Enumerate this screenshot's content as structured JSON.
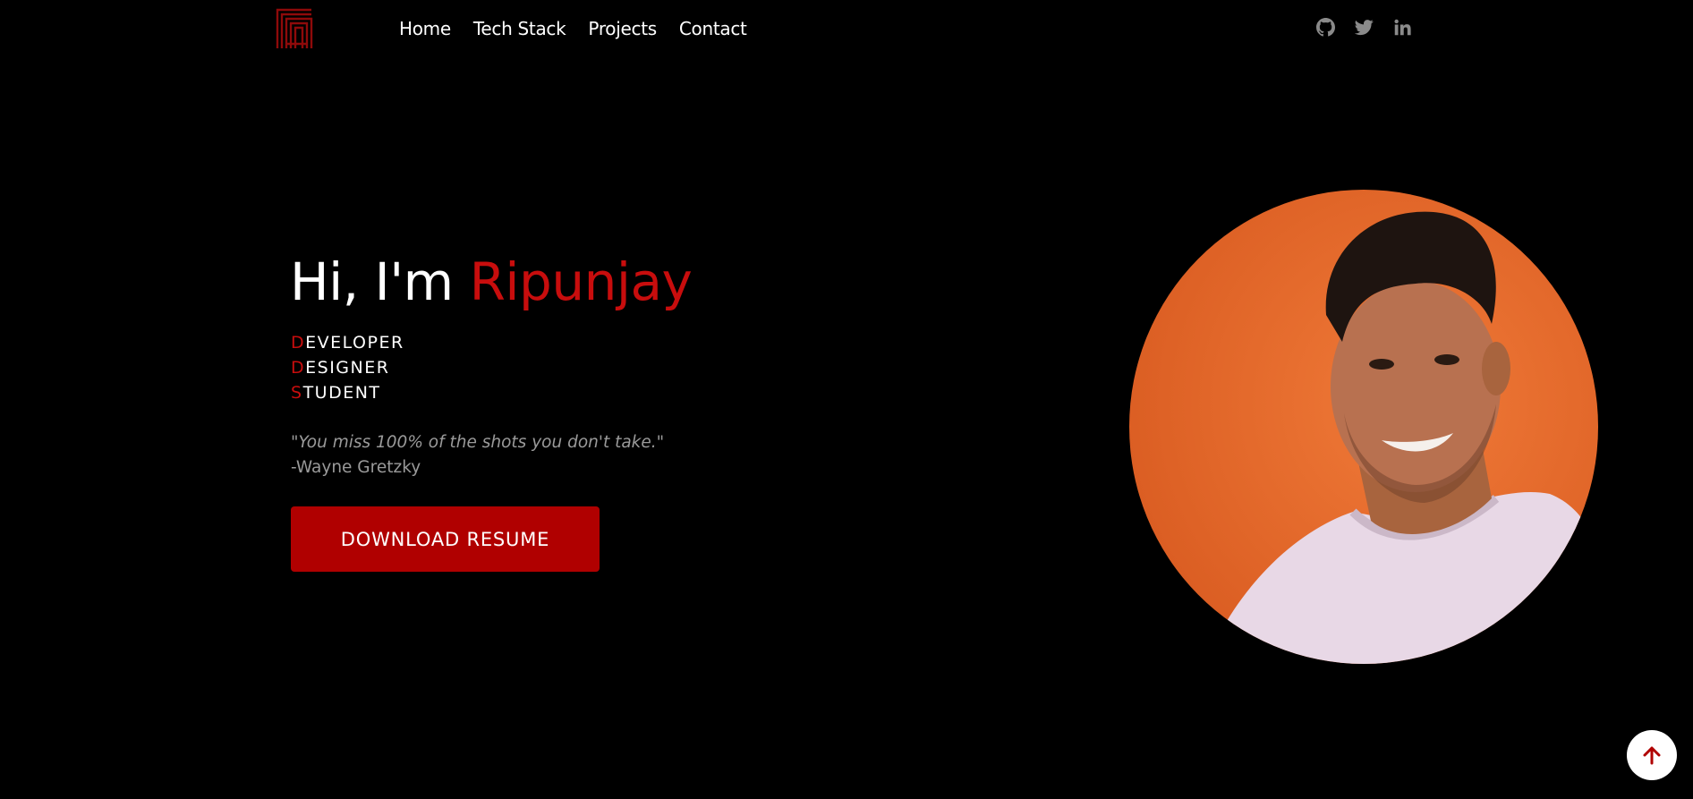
{
  "nav": {
    "logo_icon": "maze-logo-icon",
    "links": [
      "Home",
      "Tech Stack",
      "Projects",
      "Contact"
    ],
    "social_icons": [
      "github-icon",
      "twitter-icon",
      "linkedin-icon"
    ]
  },
  "hero": {
    "greeting": "Hi, I'm ",
    "name": "Ripunjay",
    "roles": [
      {
        "first": "D",
        "rest": "EVELOPER"
      },
      {
        "first": "D",
        "rest": "ESIGNER"
      },
      {
        "first": "S",
        "rest": "TUDENT"
      }
    ],
    "quote": "\"You miss 100% of the shots you don't take.\"",
    "author": "-Wayne Gretzky",
    "button_label": "DOWNLOAD RESUME",
    "photo_icon": "profile-photo"
  },
  "scroll_top_icon": "arrow-up-icon",
  "colors": {
    "background": "#000000",
    "accent": "#c80d0d",
    "button": "#b00000",
    "muted_text": "#9a9a9a",
    "photo_background": "#e8682c"
  }
}
